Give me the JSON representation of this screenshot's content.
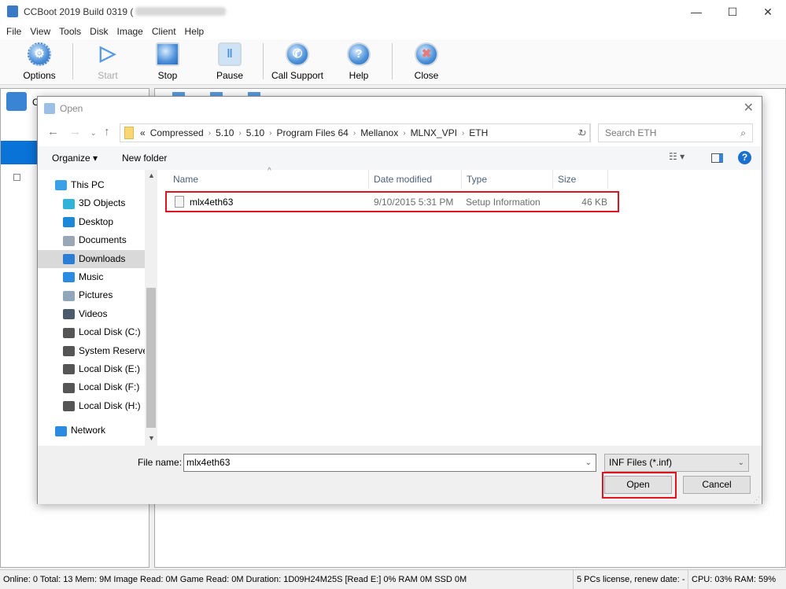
{
  "app": {
    "title": "CCBoot 2019 Build 0319 (",
    "title_blurred": true
  },
  "window_controls": {
    "minimize": "—",
    "maximize": "☐",
    "close": "✕"
  },
  "menu": [
    "File",
    "View",
    "Tools",
    "Disk",
    "Image",
    "Client",
    "Help"
  ],
  "toolbar": [
    {
      "label": "Options",
      "icon": "gear-icon",
      "enabled": true
    },
    {
      "label": "Start",
      "icon": "play-icon",
      "enabled": false
    },
    {
      "label": "Stop",
      "icon": "stop-icon",
      "enabled": true
    },
    {
      "label": "Pause",
      "icon": "pause-icon",
      "enabled": true
    },
    {
      "label": "Call Support",
      "icon": "phone-icon",
      "enabled": true
    },
    {
      "label": "Help",
      "icon": "help-icon",
      "enabled": true
    },
    {
      "label": "Close",
      "icon": "close-icon",
      "enabled": true
    }
  ],
  "left_tree": {
    "first_label_partial": "C"
  },
  "dialog": {
    "title": "Open",
    "breadcrumb": [
      "«",
      "Compressed",
      "5.10",
      "5.10",
      "Program Files 64",
      "Mellanox",
      "MLNX_VPI",
      "ETH"
    ],
    "search_placeholder": "Search ETH",
    "organize": "Organize ▾",
    "new_folder": "New folder",
    "nav": [
      {
        "label": "This PC",
        "color": "#3aa0e8",
        "level": 0
      },
      {
        "label": "3D Objects",
        "color": "#2fb3d9",
        "level": 1
      },
      {
        "label": "Desktop",
        "color": "#1e88d8",
        "level": 1
      },
      {
        "label": "Documents",
        "color": "#9aa7b5",
        "level": 1
      },
      {
        "label": "Downloads",
        "color": "#2a7fd4",
        "level": 1,
        "selected": true
      },
      {
        "label": "Music",
        "color": "#2a8be0",
        "level": 1
      },
      {
        "label": "Pictures",
        "color": "#8fa6bb",
        "level": 1
      },
      {
        "label": "Videos",
        "color": "#4b5b6b",
        "level": 1
      },
      {
        "label": "Local Disk (C:)",
        "color": "#555",
        "level": 1
      },
      {
        "label": "System Reserved",
        "color": "#555",
        "level": 1
      },
      {
        "label": "Local Disk (E:)",
        "color": "#555",
        "level": 1
      },
      {
        "label": "Local Disk (F:)",
        "color": "#555",
        "level": 1
      },
      {
        "label": "Local Disk (H:)",
        "color": "#555",
        "level": 1
      },
      {
        "label": "Network",
        "color": "#2a8be0",
        "level": 0
      }
    ],
    "columns": [
      "Name",
      "Date modified",
      "Type",
      "Size"
    ],
    "files": [
      {
        "name": "mlx4eth63",
        "date": "9/10/2015 5:31 PM",
        "type": "Setup Information",
        "size": "46 KB"
      }
    ],
    "file_name_label": "File name:",
    "file_name_value": "mlx4eth63",
    "filter": "INF Files (*.inf)",
    "open": "Open",
    "cancel": "Cancel",
    "highlight_color": "#e0141e"
  },
  "status": {
    "main": "Online: 0 Total: 13 Mem: 9M Image Read: 0M Game Read: 0M Duration: 1D09H24M25S [Read E:] 0% RAM 0M SSD 0M",
    "license": "5 PCs license, renew date: -",
    "cpu": "CPU: 03% RAM: 59%"
  }
}
